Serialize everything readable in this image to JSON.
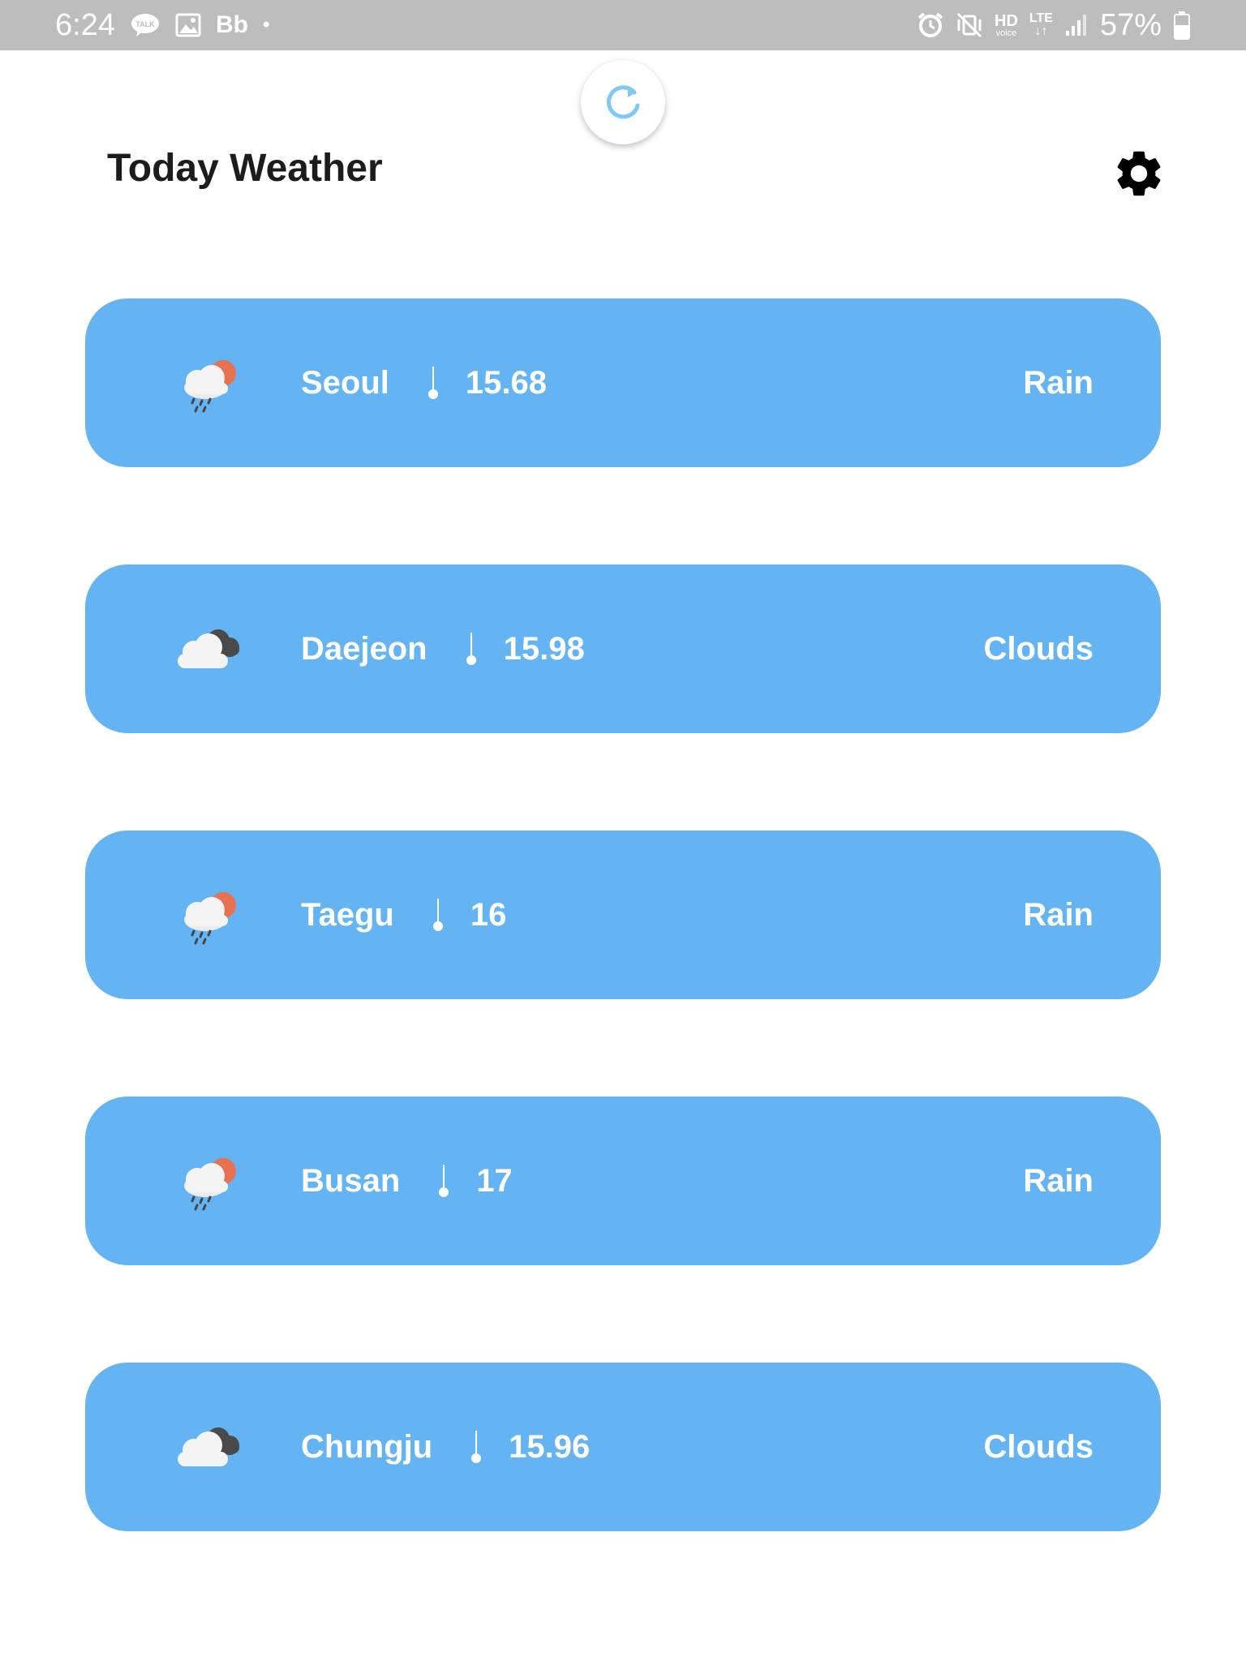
{
  "status_bar": {
    "time": "6:24",
    "talk_label": "TALK",
    "app_label": "Bb",
    "dot": "•",
    "hd_label": "HD",
    "voice_label": "voice",
    "lte_label": "LTE",
    "lte_arrows": "↓↑",
    "battery_level": "57%",
    "icons": [
      "talk-icon",
      "gallery-icon",
      "alarm-icon",
      "mute-vibrate-icon",
      "signal-icon",
      "battery-icon"
    ]
  },
  "header": {
    "title": "Today Weather",
    "refresh_icon": "refresh-icon",
    "settings_icon": "gear-icon"
  },
  "colors": {
    "card": "#64b4f4",
    "refresh": "#81c9f5",
    "title": "#1c1c1c",
    "status_bar": "#bdbdbd"
  },
  "cities": [
    {
      "name": "Seoul",
      "temp": "15.68",
      "condition": "Rain",
      "icon": "rain-sun-icon"
    },
    {
      "name": "Daejeon",
      "temp": "15.98",
      "condition": "Clouds",
      "icon": "clouds-icon"
    },
    {
      "name": "Taegu",
      "temp": "16",
      "condition": "Rain",
      "icon": "rain-sun-icon"
    },
    {
      "name": "Busan",
      "temp": "17",
      "condition": "Rain",
      "icon": "rain-sun-icon"
    },
    {
      "name": "Chungju",
      "temp": "15.96",
      "condition": "Clouds",
      "icon": "clouds-icon"
    }
  ]
}
